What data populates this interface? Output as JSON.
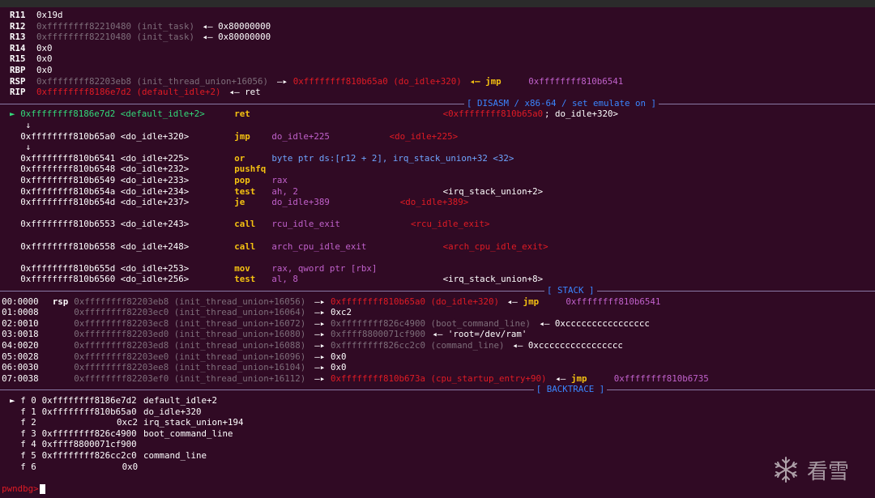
{
  "registers": [
    {
      "name": "R11",
      "value": "0x19d"
    },
    {
      "name": "R12",
      "value": "0xffffffff82210480 (init_task)",
      "arrow": "◂— 0x80000000"
    },
    {
      "name": "R13",
      "value": "0xffffffff82210480 (init_task)",
      "arrow": "◂— 0x80000000"
    },
    {
      "name": "R14",
      "value": "0x0"
    },
    {
      "name": "R15",
      "value": "0x0"
    },
    {
      "name": "RBP",
      "value": "0x0"
    },
    {
      "name": "RSP",
      "value": "0xffffffff82203eb8 (init_thread_union+16056)",
      "arrow": "—▸",
      "target": "0xffffffff810b65a0 (do_idle+320)",
      "arrow2": "◂— jmp",
      "tail": "0xffffffff810b6541"
    },
    {
      "name": "RIP",
      "value": "0xffffffff8186e7d2 (default_idle+2)",
      "arrow": "◂— ret"
    }
  ],
  "disasm_title": "[ DISASM / x86-64 / set emulate on ]",
  "disasm": [
    {
      "marker": "►",
      "addr": "0xffffffff8186e7d2 <default_idle+2>",
      "mnem": "ret",
      "ops": "",
      "comment_red": "<0xffffffff810b65a0",
      "comment": "; do_idle+320>",
      "current": true
    },
    {
      "arrow_down": "↓"
    },
    {
      "addr": "0xffffffff810b65a0 <do_idle+320>",
      "mnem": "jmp",
      "ops": "do_idle+225",
      "comment_red": "<do_idle+225>"
    },
    {
      "arrow_down": "↓"
    },
    {
      "addr": "0xffffffff810b6541 <do_idle+225>",
      "mnem": "or",
      "ops": "byte ptr ds:[r12 + 2], irq_stack_union+32 <32>"
    },
    {
      "addr": "0xffffffff810b6548 <do_idle+232>",
      "mnem": "pushfq",
      "ops": ""
    },
    {
      "addr": "0xffffffff810b6549 <do_idle+233>",
      "mnem": "pop",
      "ops": "rax"
    },
    {
      "addr": "0xffffffff810b654a <do_idle+234>",
      "mnem": "test",
      "ops": "ah, 2",
      "comment": "<irq_stack_union+2>"
    },
    {
      "addr": "0xffffffff810b654d <do_idle+237>",
      "mnem": "je",
      "ops": "do_idle+389",
      "comment_red": "<do_idle+389>"
    },
    {
      "blank": true
    },
    {
      "addr": "0xffffffff810b6553 <do_idle+243>",
      "mnem": "call",
      "ops": "rcu_idle_exit",
      "comment_red": "<rcu_idle_exit>"
    },
    {
      "blank": true
    },
    {
      "addr": "0xffffffff810b6558 <do_idle+248>",
      "mnem": "call",
      "ops": "arch_cpu_idle_exit",
      "comment_red": "<arch_cpu_idle_exit>"
    },
    {
      "blank": true
    },
    {
      "addr": "0xffffffff810b655d <do_idle+253>",
      "mnem": "mov",
      "ops": "rax, qword ptr [rbx]"
    },
    {
      "addr": "0xffffffff810b6560 <do_idle+256>",
      "mnem": "test",
      "ops": "al, 8",
      "comment": "<irq_stack_union+8>"
    }
  ],
  "stack_title": "[ STACK ]",
  "stack": [
    {
      "idx": "00:0000",
      "label": "rsp",
      "addr": "0xffffffff82203eb8 (init_thread_union+16056)",
      "target_red": "0xffffffff810b65a0 (do_idle+320)",
      "extra": "◂— jmp",
      "tail": "0xffffffff810b6541"
    },
    {
      "idx": "01:0008",
      "label": "",
      "addr": "0xffffffff82203ec0 (init_thread_union+16064)",
      "target": "0xc2"
    },
    {
      "idx": "02:0010",
      "label": "",
      "addr": "0xffffffff82203ec8 (init_thread_union+16072)",
      "target_gray": "0xffffffff826c4900 (boot_command_line)",
      "extra": "◂— 0xcccccccccccccccc"
    },
    {
      "idx": "03:0018",
      "label": "",
      "addr": "0xffffffff82203ed0 (init_thread_union+16080)",
      "target_gray": "0xffff8800071cf900",
      "extra": "◂— 'root=/dev/ram'"
    },
    {
      "idx": "04:0020",
      "label": "",
      "addr": "0xffffffff82203ed8 (init_thread_union+16088)",
      "target_gray": "0xffffffff826cc2c0 (command_line)",
      "extra": "◂— 0xcccccccccccccccc"
    },
    {
      "idx": "05:0028",
      "label": "",
      "addr": "0xffffffff82203ee0 (init_thread_union+16096)",
      "target": "0x0"
    },
    {
      "idx": "06:0030",
      "label": "",
      "addr": "0xffffffff82203ee8 (init_thread_union+16104)",
      "target": "0x0"
    },
    {
      "idx": "07:0038",
      "label": "",
      "addr": "0xffffffff82203ef0 (init_thread_union+16112)",
      "target_red": "0xffffffff810b673a (cpu_startup_entry+90)",
      "extra": "◂— jmp",
      "tail": "0xffffffff810b6735"
    }
  ],
  "backtrace_title": "[ BACKTRACE ]",
  "backtrace": [
    {
      "marker": "►",
      "frame": "f 0",
      "addr": "0xffffffff8186e7d2",
      "sym": "default_idle+2"
    },
    {
      "frame": "f 1",
      "addr": "0xffffffff810b65a0",
      "sym": "do_idle+320"
    },
    {
      "frame": "f 2",
      "addr": "0xc2",
      "sym": "irq_stack_union+194"
    },
    {
      "frame": "f 3",
      "addr": "0xffffffff826c4900",
      "sym": "boot_command_line"
    },
    {
      "frame": "f 4",
      "addr": "0xffff8800071cf900",
      "sym": ""
    },
    {
      "frame": "f 5",
      "addr": "0xffffffff826cc2c0",
      "sym": "command_line"
    },
    {
      "frame": "f 6",
      "addr": "0x0",
      "sym": ""
    }
  ],
  "prompt": "pwndbg>",
  "watermark": {
    "icon": "snowflake-icon",
    "text": "看雪"
  },
  "colors": {
    "background": "#300a24",
    "red": "#e01b24",
    "purple": "#c061cb",
    "yellow": "#f5c211",
    "green": "#33da7a",
    "blue": "#3a86ff",
    "gray": "#7e6e7a"
  }
}
